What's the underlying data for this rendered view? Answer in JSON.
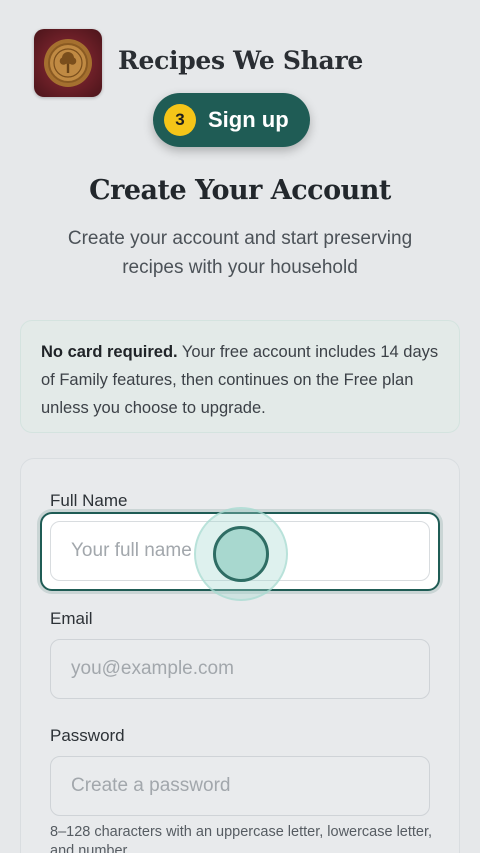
{
  "header": {
    "brand_name": "Recipes We Share",
    "logo_icon": "tree-seal-icon"
  },
  "step_pill": {
    "number": "3",
    "label": "Sign up"
  },
  "main": {
    "title": "Create Your Account",
    "subtitle": "Create your account and start preserving recipes with your household"
  },
  "notice": {
    "bold": "No card required.",
    "text": " Your free account includes 14 days of Family features, then continues on the Free plan unless you choose to upgrade."
  },
  "form": {
    "full_name": {
      "label": "Full Name",
      "placeholder": "Your full name",
      "value": ""
    },
    "email": {
      "label": "Email",
      "placeholder": "you@example.com",
      "value": ""
    },
    "password": {
      "label": "Password",
      "placeholder": "Create a password",
      "value": "",
      "hint": "8–128 characters with an uppercase letter, lowercase letter, and number."
    }
  },
  "colors": {
    "accent": "#1f5c55",
    "step_badge": "#f5c518",
    "logo_bg": "#6b1f27"
  }
}
